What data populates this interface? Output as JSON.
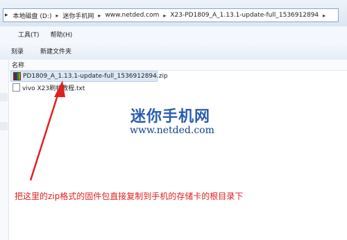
{
  "address_bar": {
    "crumbs": [
      "本地磁盘 (D:)",
      "迷你手机网",
      "www.netded.com",
      "X23-PD1809_A_1.13.1-update-full_1536912894"
    ]
  },
  "menubar": {
    "items": [
      "工具(T)",
      "帮助(H)"
    ]
  },
  "toolbar": {
    "burn": "刻录",
    "new_folder": "新建文件夹"
  },
  "list": {
    "column_name": "名称",
    "files": [
      {
        "name": "PD1809_A_1.13.1-update-full_1536912894.zip",
        "icon": "zip-icon",
        "selected": true
      },
      {
        "name": "vivo X23刷机教程.txt",
        "icon": "text-file-icon",
        "selected": false
      }
    ]
  },
  "watermark": {
    "title": "迷你手机网",
    "url": "www.netded.com"
  },
  "annotation": {
    "text": "把这里的zip格式的固件包直接复制到手机的存储卡的根目录下",
    "color": "#e21f1f"
  }
}
